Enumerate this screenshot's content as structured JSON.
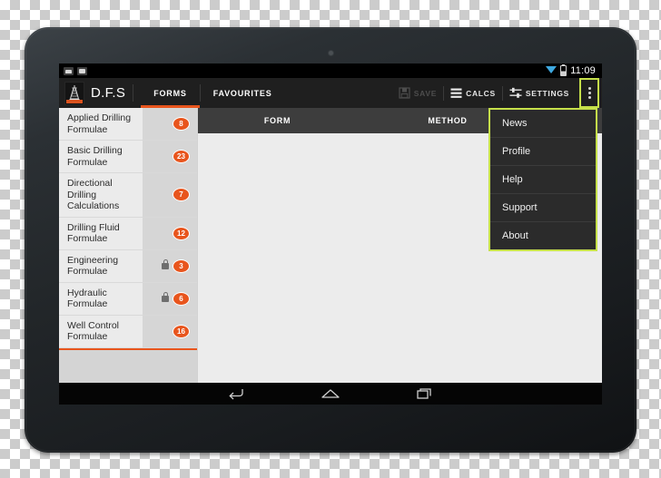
{
  "device": {
    "type": "android-tablet",
    "camera": "front-camera"
  },
  "statusbar": {
    "notification_icons": [
      "screenshot-icon",
      "usb-icon"
    ],
    "wifi_icon": "wifi-icon",
    "battery_icon": "battery-icon",
    "time": "11:09"
  },
  "appbar": {
    "logo_icon": "drilling-rig-icon",
    "title": "D.F.S",
    "tabs": [
      {
        "label": "FORMS",
        "active": true
      },
      {
        "label": "FAVOURITES",
        "active": false
      }
    ],
    "actions": [
      {
        "label": "SAVE",
        "icon": "save-floppy-icon",
        "disabled": true
      },
      {
        "label": "CALCS",
        "icon": "list-lines-icon",
        "disabled": false
      },
      {
        "label": "SETTINGS",
        "icon": "sliders-icon",
        "disabled": false
      }
    ],
    "overflow_icon": "overflow-dots-icon"
  },
  "overflow_menu": {
    "highlight_color": "#c6e04a",
    "items": [
      {
        "label": "News"
      },
      {
        "label": "Profile"
      },
      {
        "label": "Help"
      },
      {
        "label": "Support"
      },
      {
        "label": "About"
      }
    ]
  },
  "sidebar": {
    "items": [
      {
        "label": "Applied Drilling Formulae",
        "badge": "8",
        "locked": false
      },
      {
        "label": "Basic Drilling Formulae",
        "badge": "23",
        "locked": false
      },
      {
        "label": "Directional Drilling Calculations",
        "badge": "7",
        "locked": false
      },
      {
        "label": "Drilling Fluid Formulae",
        "badge": "12",
        "locked": false
      },
      {
        "label": "Engineering Formulae",
        "badge": "3",
        "locked": true
      },
      {
        "label": "Hydraulic Formulae",
        "badge": "6",
        "locked": true
      },
      {
        "label": "Well Control Formulae",
        "badge": "16",
        "locked": false
      }
    ]
  },
  "main": {
    "columns": [
      {
        "label": "FORM"
      },
      {
        "label": "METHOD"
      }
    ]
  },
  "navbar": {
    "buttons": [
      {
        "name": "back-icon"
      },
      {
        "name": "home-icon"
      },
      {
        "name": "recents-icon"
      }
    ]
  },
  "colors": {
    "accent_orange": "#e8551d",
    "highlight_lime": "#c6e04a",
    "appbar_dark": "#1f1f1f"
  }
}
